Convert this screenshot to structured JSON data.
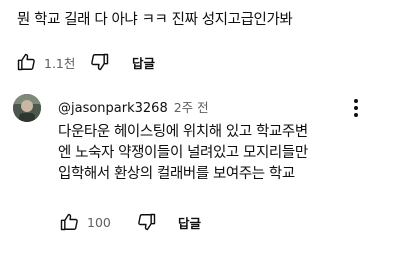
{
  "top_comment": {
    "text": "뭔 학교 길래 다 아냐 ㅋㅋ 진짜 성지고급인가봐",
    "like_count": "1.1천",
    "reply_label": "답글"
  },
  "reply": {
    "handle": "@jasonpark3268",
    "time": "2주 전",
    "lines": [
      "다운타운 헤이스팅에 위치해 있고 학교주변",
      "엔 노숙자 약쟁이들이 널려있고 모지리들만",
      "입학해서 환상의 컬래버를 보여주는 학교"
    ],
    "like_count": "100",
    "reply_label": "답글"
  },
  "icons": {
    "like": "thumbs-up-icon",
    "dislike": "thumbs-down-icon",
    "menu": "more-vertical-icon",
    "avatar": "user-avatar"
  }
}
